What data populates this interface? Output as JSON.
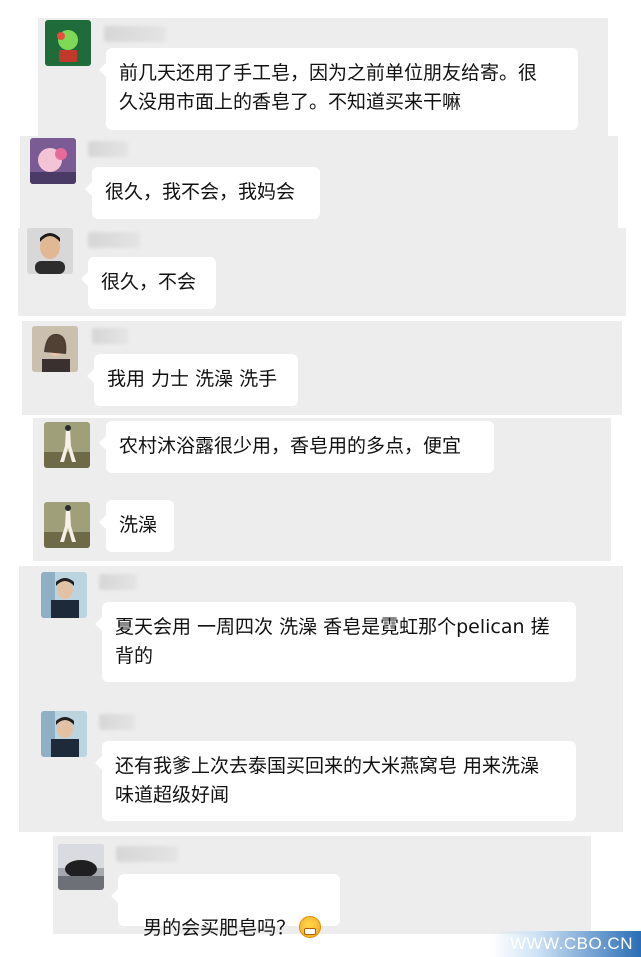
{
  "messages": [
    {
      "text": "前几天还用了手工皂，因为之前单位朋友给寄。很\n久没用市面上的香皂了。不知道买来干嘛"
    },
    {
      "text": "很久，我不会，我妈会"
    },
    {
      "text": "很久，不会"
    },
    {
      "text": "我用 力士 洗澡 洗手"
    },
    {
      "text": "农村沐浴露很少用，香皂用的多点，便宜"
    },
    {
      "text": "洗澡"
    },
    {
      "text": "夏天会用 一周四次 洗澡 香皂是霓虹那个pelican 搓\n背的"
    },
    {
      "text": "还有我爹上次去泰国买回来的大米燕窝皂 用来洗澡\n味道超级好闻"
    },
    {
      "text": "男的会买肥皂吗？"
    }
  ],
  "watermark": "WWW.CBO.CN"
}
